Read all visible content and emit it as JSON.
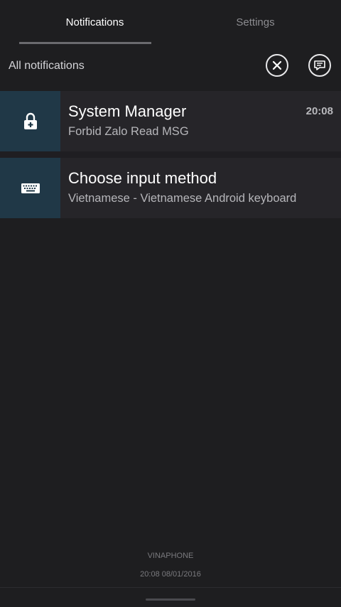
{
  "tabs": {
    "notifications_label": "Notifications",
    "settings_label": "Settings"
  },
  "header": {
    "title": "All notifications",
    "clear_icon": "close-circle-icon",
    "message_icon": "chat-bubble-icon"
  },
  "notifications": [
    {
      "title": "System Manager",
      "subtitle": "Forbid Zalo Read MSG",
      "time": "20:08",
      "icon": "lock-plus-icon"
    },
    {
      "title": "Choose input method",
      "subtitle": "Vietnamese - Vietnamese Android keyboard",
      "time": "",
      "icon": "keyboard-icon"
    }
  ],
  "footer": {
    "carrier": "VINAPHONE",
    "datetime": "20:08  08/01/2016"
  },
  "colors": {
    "background": "#1e1e20",
    "card": "#262529",
    "icon_box": "#203847",
    "active_tab_underline": "#6a6a6e"
  }
}
